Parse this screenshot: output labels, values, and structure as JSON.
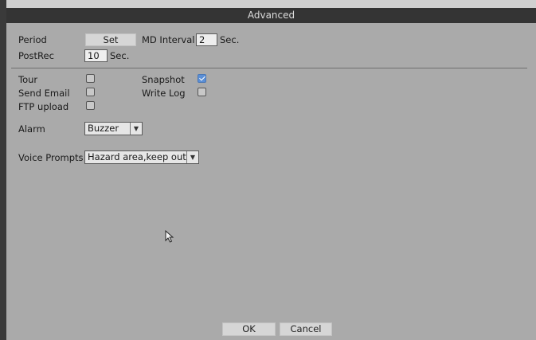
{
  "window": {
    "title": "Advanced"
  },
  "settings": {
    "period_label": "Period",
    "period_button": "Set",
    "md_interval_label": "MD Interval",
    "md_interval_value": "2",
    "md_interval_unit": "Sec.",
    "postrec_label": "PostRec",
    "postrec_value": "10",
    "postrec_unit": "Sec."
  },
  "options": {
    "tour_label": "Tour",
    "tour_checked": false,
    "snapshot_label": "Snapshot",
    "snapshot_checked": true,
    "send_email_label": "Send Email",
    "send_email_checked": false,
    "write_log_label": "Write Log",
    "write_log_checked": false,
    "ftp_upload_label": "FTP upload",
    "ftp_upload_checked": false
  },
  "alarm": {
    "label": "Alarm",
    "selected": "Buzzer"
  },
  "voice": {
    "label": "Voice Prompts",
    "selected": "Hazard area,keep out"
  },
  "footer": {
    "ok_label": "OK",
    "cancel_label": "Cancel"
  },
  "colors": {
    "titlebar": "#343434",
    "panel": "#aaaaaa",
    "check_accent": "#5b8fd6"
  }
}
